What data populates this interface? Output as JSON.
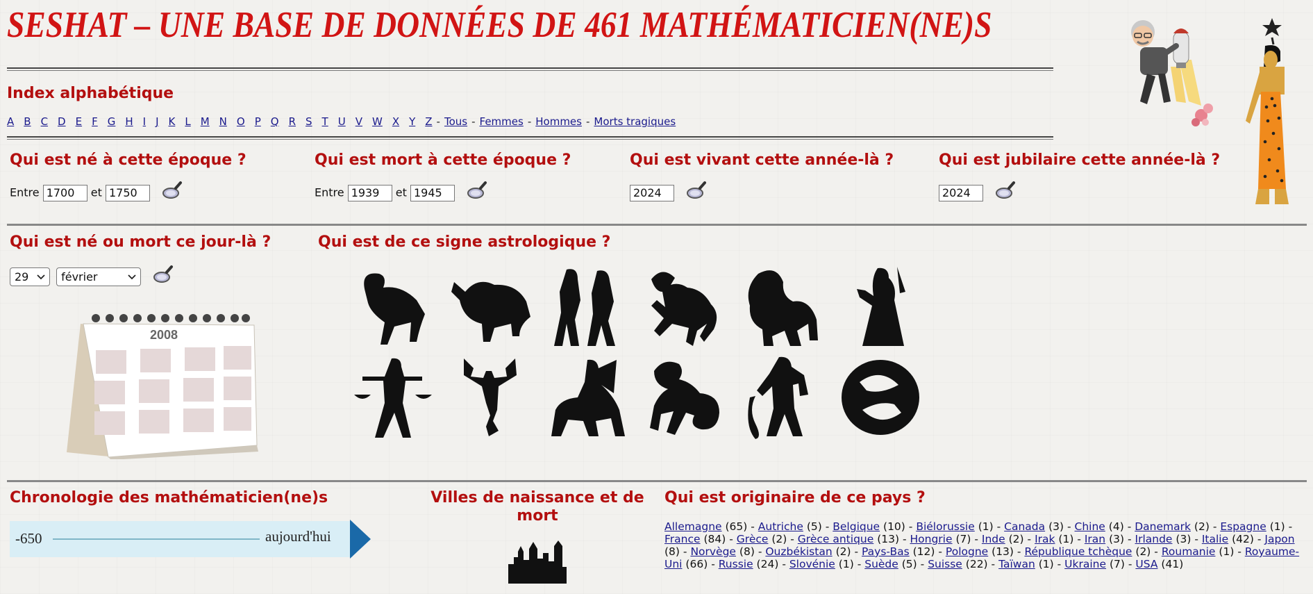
{
  "header": {
    "title": "SESHAT – UNE BASE DE DONNÉES DE 461 MATHÉMATICIEN(NE)S"
  },
  "index": {
    "heading": "Index alphabétique",
    "letters": [
      "A",
      "B",
      "C",
      "D",
      "E",
      "F",
      "G",
      "H",
      "I",
      "J",
      "K",
      "L",
      "M",
      "N",
      "O",
      "P",
      "Q",
      "R",
      "S",
      "T",
      "U",
      "V",
      "W",
      "X",
      "Y",
      "Z"
    ],
    "links": [
      "Tous",
      "Femmes",
      "Hommes",
      "Morts tragiques"
    ],
    "separator": "-"
  },
  "born_era": {
    "heading": "Qui est né à cette époque ?",
    "between": "Entre",
    "and": "et",
    "from": "1700",
    "to": "1750"
  },
  "died_era": {
    "heading": "Qui est mort à cette époque ?",
    "between": "Entre",
    "and": "et",
    "from": "1939",
    "to": "1945"
  },
  "alive_year": {
    "heading": "Qui est vivant cette année-là ?",
    "year": "2024"
  },
  "jubilee_year": {
    "heading": "Qui est jubilaire cette année-là ?",
    "year": "2024"
  },
  "day": {
    "heading": "Qui est né ou mort ce jour-là ?",
    "day": "29",
    "month": "février",
    "calendar_year": "2008"
  },
  "zodiac": {
    "heading": "Qui est de ce signe astrologique ?",
    "signs": [
      "aries",
      "taurus",
      "gemini",
      "cancer",
      "leo",
      "virgo",
      "libra",
      "scorpio",
      "sagittarius",
      "capricorn",
      "aquarius",
      "pisces"
    ]
  },
  "chronology": {
    "heading": "Chronologie des mathématicien(ne)s",
    "start": "-650",
    "end": "aujourd'hui"
  },
  "cities": {
    "heading": "Villes de naissance et de mort"
  },
  "countries": {
    "heading": "Qui est originaire de ce pays ?",
    "items": [
      {
        "name": "Allemagne",
        "count": "(65)"
      },
      {
        "name": "Autriche",
        "count": "(5)"
      },
      {
        "name": "Belgique",
        "count": "(10)"
      },
      {
        "name": "Biélorussie",
        "count": "(1)"
      },
      {
        "name": "Canada",
        "count": "(3)"
      },
      {
        "name": "Chine",
        "count": "(4)"
      },
      {
        "name": "Danemark",
        "count": "(2)"
      },
      {
        "name": "Espagne",
        "count": "(1)"
      },
      {
        "name": "France",
        "count": "(84)"
      },
      {
        "name": "Grèce",
        "count": "(2)"
      },
      {
        "name": "Grèce antique",
        "count": "(13)"
      },
      {
        "name": "Hongrie",
        "count": "(7)"
      },
      {
        "name": "Inde",
        "count": "(2)"
      },
      {
        "name": "Irak",
        "count": "(1)"
      },
      {
        "name": "Iran",
        "count": "(3)"
      },
      {
        "name": "Irlande",
        "count": "(3)"
      },
      {
        "name": "Italie",
        "count": "(42)"
      },
      {
        "name": "Japon",
        "count": "(8)"
      },
      {
        "name": "Norvège",
        "count": "(8)"
      },
      {
        "name": "Ouzbékistan",
        "count": "(2)"
      },
      {
        "name": "Pays-Bas",
        "count": "(12)"
      },
      {
        "name": "Pologne",
        "count": "(13)"
      },
      {
        "name": "République tchèque",
        "count": "(2)"
      },
      {
        "name": "Roumanie",
        "count": "(1)"
      },
      {
        "name": "Royaume-Uni",
        "count": "(66)"
      },
      {
        "name": "Russie",
        "count": "(24)"
      },
      {
        "name": "Slovénie",
        "count": "(1)"
      },
      {
        "name": "Suède",
        "count": "(5)"
      },
      {
        "name": "Suisse",
        "count": "(22)"
      },
      {
        "name": "Taïwan",
        "count": "(1)"
      },
      {
        "name": "Ukraine",
        "count": "(7)"
      },
      {
        "name": "USA",
        "count": "(41)"
      }
    ]
  },
  "colors": {
    "title_red": "#d11414",
    "heading_red": "#b30f0f",
    "link_blue": "#1a1a8c"
  },
  "icons": {
    "search": "magnifier-icon",
    "mascot": "jetpack-mascot-icon",
    "goddess": "seshat-goddess-icon",
    "calendar": "desk-calendar-icon",
    "city": "city-skyline-icon",
    "timeline_arrow": "arrow-right-icon"
  }
}
